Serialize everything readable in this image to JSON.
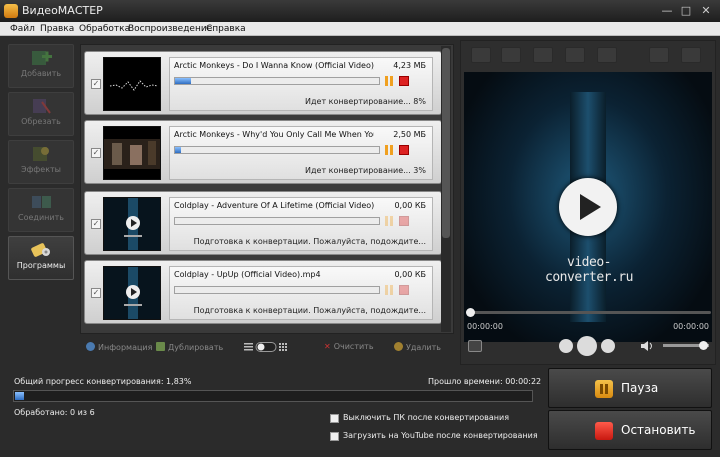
{
  "window": {
    "title": "ВидеоМАСТЕР",
    "controls": [
      "minimize-icon",
      "maximize-icon",
      "close-icon"
    ]
  },
  "menu": [
    "Файл",
    "Правка",
    "Обработка",
    "Воспроизведение",
    "Справка"
  ],
  "sidebar": {
    "items": [
      {
        "label": "Добавить",
        "icon": "add-video-icon",
        "active": false
      },
      {
        "label": "Обрезать",
        "icon": "cut-icon",
        "active": false
      },
      {
        "label": "Эффекты",
        "icon": "effects-icon",
        "active": false
      },
      {
        "label": "Соединить",
        "icon": "join-icon",
        "active": false
      },
      {
        "label": "Программы",
        "icon": "programs-icon",
        "active": true
      }
    ]
  },
  "files": [
    {
      "name": "Arctic Monkeys - Do I Wanna Know (Official Video)_converte",
      "size": "4,23 МБ",
      "status": "Идет конвертирование... 8%",
      "progress": 0.08,
      "active": true,
      "thumb": "waveform"
    },
    {
      "name": "Arctic Monkeys - Why'd You Only Call Me When You're High (",
      "size": "2,50 МБ",
      "status": "Идет конвертирование... 3%",
      "progress": 0.03,
      "active": true,
      "thumb": "scene"
    },
    {
      "name": "Coldplay - Adventure Of A Lifetime (Official Video).mp4",
      "size": "0,00 КБ",
      "status": "Подготовка к конвертации. Пожалуйста, подождите...",
      "progress": 0,
      "active": false,
      "thumb": "player"
    },
    {
      "name": "Coldplay - UpUp (Official Video).mp4",
      "size": "0,00 КБ",
      "status": "Подготовка к конвертации. Пожалуйста, подождите...",
      "progress": 0,
      "active": false,
      "thumb": "player"
    }
  ],
  "list_toolbar": {
    "info": "Информация",
    "duplicate": "Дублировать",
    "clear": "Очистить",
    "delete": "Удалить"
  },
  "player": {
    "tools": [
      "crop-icon",
      "rotate-icon",
      "brightness-icon",
      "fps-icon",
      "speed-icon",
      "gif-icon",
      "fullscreen-icon"
    ],
    "watermark": "video-converter.ru",
    "time_current": "00:00:00",
    "time_total": "00:00:00",
    "seek_position": 0,
    "volume": 0.8
  },
  "status": {
    "overall_label": "Общий прогресс конвертирования: 1,83%",
    "overall_progress": 0.0183,
    "elapsed_label": "Прошло времени: 00:00:22",
    "processed_label": "Обработано: 0 из 6",
    "opt_shutdown": "Выключить ПК после конвертирования",
    "opt_youtube": "Загрузить на YouTube после конвертирования"
  },
  "actions": {
    "pause": "Пауза",
    "stop": "Остановить"
  },
  "colors": {
    "accent_progress": "#2f6dc0",
    "pause_icon": "#f0a020",
    "stop_icon": "#d22222"
  }
}
